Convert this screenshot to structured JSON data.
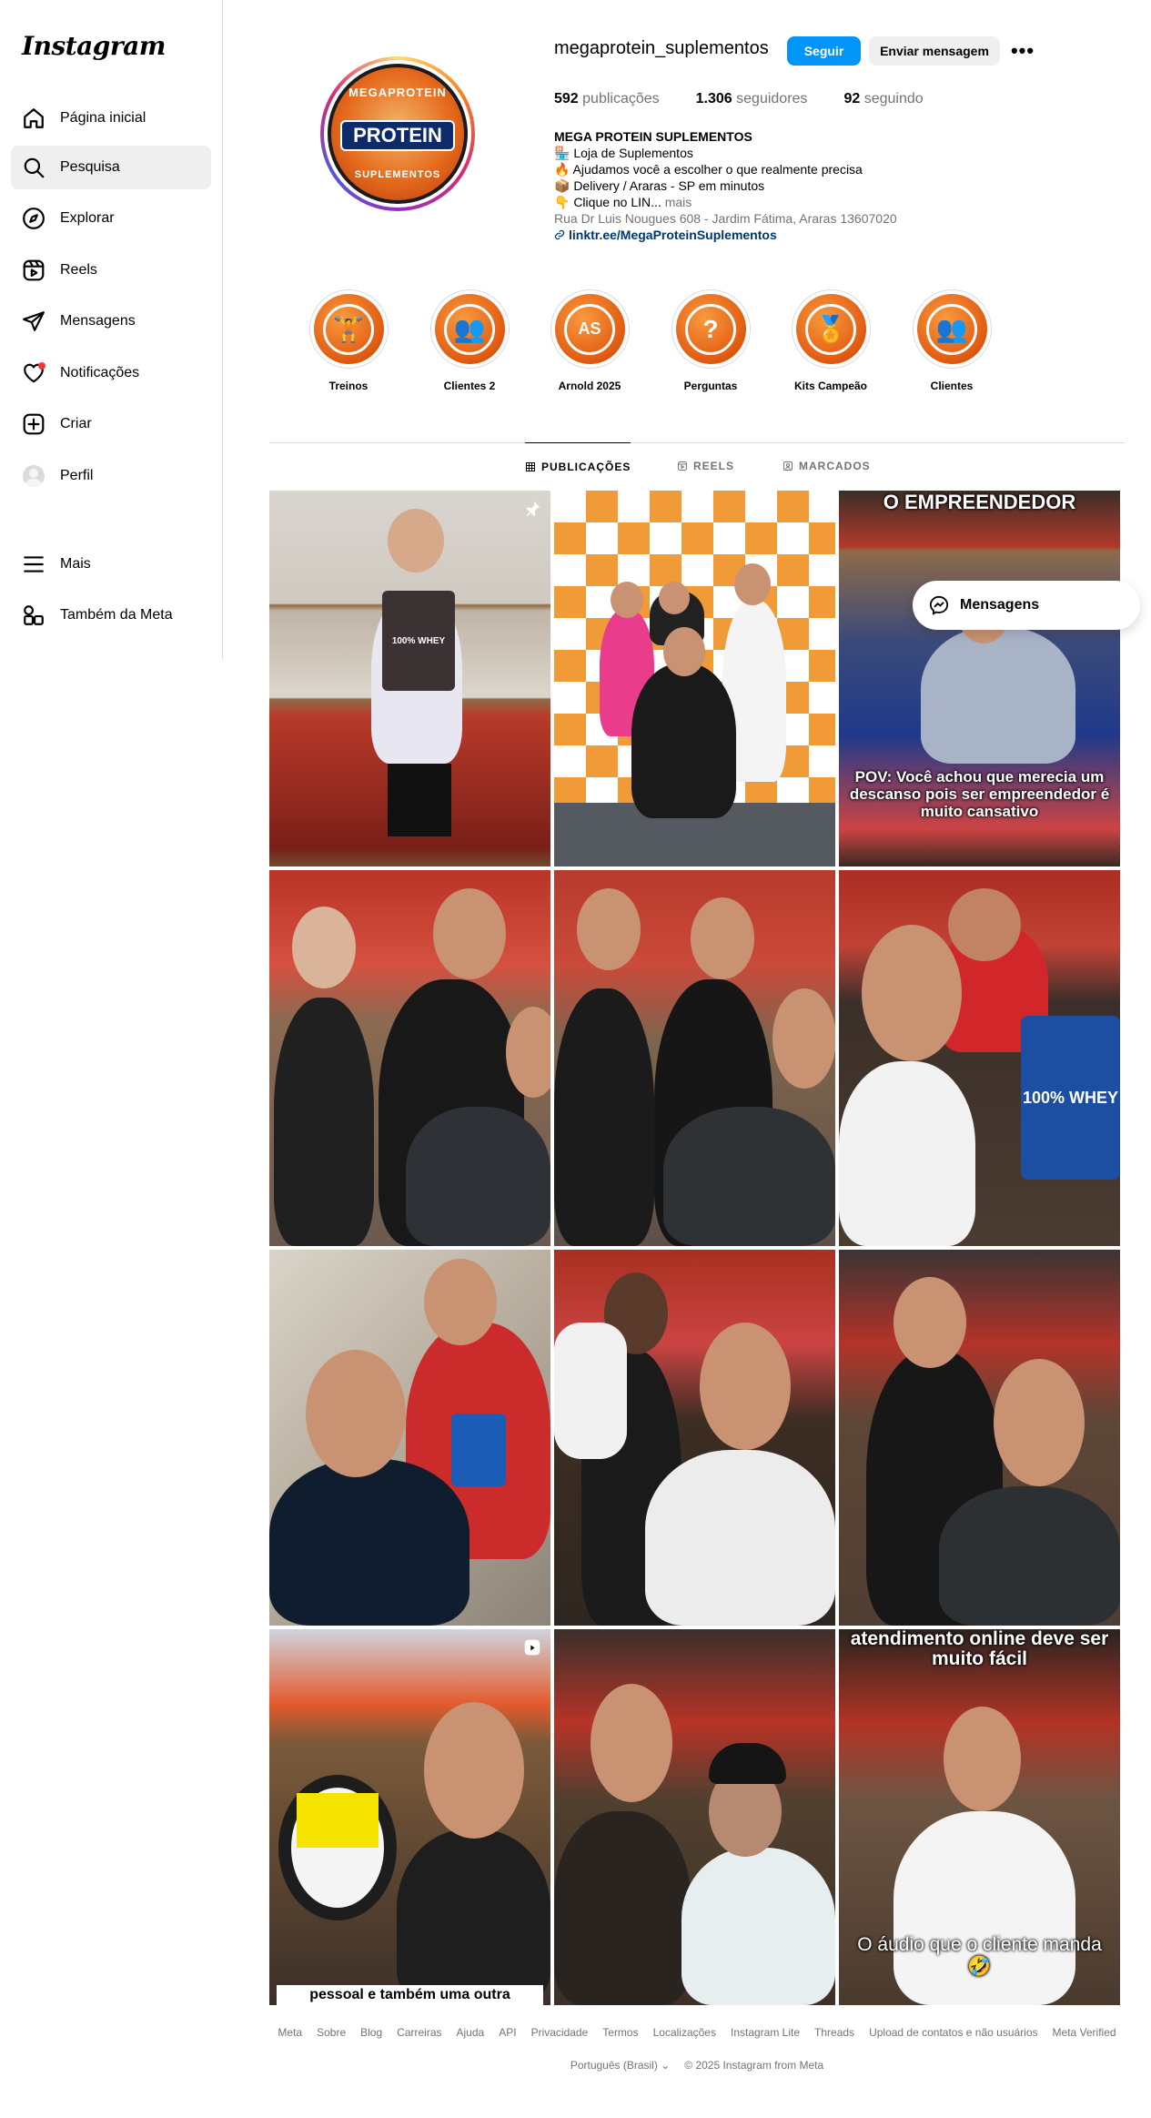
{
  "app": {
    "logo": "Instagram"
  },
  "sidebar": {
    "items": [
      {
        "label": "Página inicial",
        "icon": "home-icon"
      },
      {
        "label": "Pesquisa",
        "icon": "search-icon"
      },
      {
        "label": "Explorar",
        "icon": "compass-icon"
      },
      {
        "label": "Reels",
        "icon": "reels-icon"
      },
      {
        "label": "Mensagens",
        "icon": "send-icon"
      },
      {
        "label": "Notificações",
        "icon": "heart-icon"
      },
      {
        "label": "Criar",
        "icon": "plus-square-icon"
      },
      {
        "label": "Perfil",
        "icon": "avatar-icon"
      },
      {
        "label": "Mais",
        "icon": "menu-icon"
      },
      {
        "label": "Também da Meta",
        "icon": "meta-apps-icon"
      }
    ]
  },
  "profile": {
    "username": "megaprotein_suplementos",
    "follow_label": "Seguir",
    "message_label": "Enviar mensagem",
    "more_label": "•••",
    "pic_text_top": "MEGAPROTEIN",
    "pic_text_mid": "PROTEIN",
    "pic_text_bot": "SUPLEMENTOS",
    "stats": {
      "posts_num": "592",
      "posts_label": "publicações",
      "followers_num": "1.306",
      "followers_label": "seguidores",
      "following_num": "92",
      "following_label": "seguindo"
    },
    "bio": {
      "name": "MEGA PROTEIN SUPLEMENTOS",
      "line1": "🏪 Loja de Suplementos",
      "line2": "🔥 Ajudamos você a escolher o que realmente precisa",
      "line3": "📦 Delivery / Araras - SP em minutos",
      "line4": "👇 Clique no LIN...",
      "more": "mais",
      "address": "Rua Dr Luis Nougues 608 - Jardim Fátima, Araras 13607020",
      "link": "linktr.ee/MegaProteinSuplementos"
    }
  },
  "highlights": [
    {
      "label": "Treinos",
      "glyph": "🏋"
    },
    {
      "label": "Clientes 2",
      "glyph": "👥"
    },
    {
      "label": "Arnold 2025",
      "glyph": "AS"
    },
    {
      "label": "Perguntas",
      "glyph": "?"
    },
    {
      "label": "Kits Campeão",
      "glyph": "🏅"
    },
    {
      "label": "Clientes",
      "glyph": "👥"
    }
  ],
  "tabs": {
    "posts": "PUBLICAÇÕES",
    "reels": "REELS",
    "tagged": "MARCADOS"
  },
  "posts": {
    "p3_caption_top": "O EMPREENDEDOR",
    "p3_caption_bottom": "POV: Você achou que merecia um descanso pois ser empreendedor é muito cansativo",
    "p10_caption": "pessoal e também uma outra",
    "p12_caption_top": "atendimento online deve ser muito fácil",
    "p12_caption_bottom": "O áudio que o cliente manda 🤣",
    "p1_bag": "100% WHEY",
    "p6_bag": "100% WHEY"
  },
  "floating": {
    "messages_label": "Mensagens"
  },
  "footer": {
    "links": [
      "Meta",
      "Sobre",
      "Blog",
      "Carreiras",
      "Ajuda",
      "API",
      "Privacidade",
      "Termos",
      "Localizações",
      "Instagram Lite",
      "Threads",
      "Upload de contatos e não usuários",
      "Meta Verified"
    ],
    "language": "Português (Brasil)",
    "copyright": "© 2025 Instagram from Meta"
  },
  "colors": {
    "accent": "#0095f6",
    "link": "#00376b",
    "muted": "#737373",
    "notification": "#ff3040"
  }
}
